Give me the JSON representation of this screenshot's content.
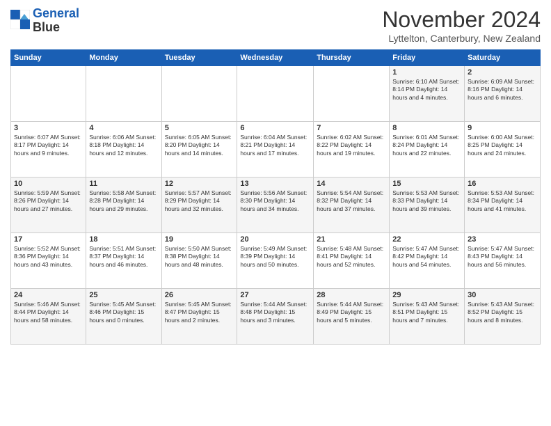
{
  "header": {
    "logo_line1": "General",
    "logo_line2": "Blue",
    "title": "November 2024",
    "location": "Lyttelton, Canterbury, New Zealand"
  },
  "days_of_week": [
    "Sunday",
    "Monday",
    "Tuesday",
    "Wednesday",
    "Thursday",
    "Friday",
    "Saturday"
  ],
  "weeks": [
    [
      {
        "day": "",
        "info": ""
      },
      {
        "day": "",
        "info": ""
      },
      {
        "day": "",
        "info": ""
      },
      {
        "day": "",
        "info": ""
      },
      {
        "day": "",
        "info": ""
      },
      {
        "day": "1",
        "info": "Sunrise: 6:10 AM\nSunset: 8:14 PM\nDaylight: 14 hours\nand 4 minutes."
      },
      {
        "day": "2",
        "info": "Sunrise: 6:09 AM\nSunset: 8:16 PM\nDaylight: 14 hours\nand 6 minutes."
      }
    ],
    [
      {
        "day": "3",
        "info": "Sunrise: 6:07 AM\nSunset: 8:17 PM\nDaylight: 14 hours\nand 9 minutes."
      },
      {
        "day": "4",
        "info": "Sunrise: 6:06 AM\nSunset: 8:18 PM\nDaylight: 14 hours\nand 12 minutes."
      },
      {
        "day": "5",
        "info": "Sunrise: 6:05 AM\nSunset: 8:20 PM\nDaylight: 14 hours\nand 14 minutes."
      },
      {
        "day": "6",
        "info": "Sunrise: 6:04 AM\nSunset: 8:21 PM\nDaylight: 14 hours\nand 17 minutes."
      },
      {
        "day": "7",
        "info": "Sunrise: 6:02 AM\nSunset: 8:22 PM\nDaylight: 14 hours\nand 19 minutes."
      },
      {
        "day": "8",
        "info": "Sunrise: 6:01 AM\nSunset: 8:24 PM\nDaylight: 14 hours\nand 22 minutes."
      },
      {
        "day": "9",
        "info": "Sunrise: 6:00 AM\nSunset: 8:25 PM\nDaylight: 14 hours\nand 24 minutes."
      }
    ],
    [
      {
        "day": "10",
        "info": "Sunrise: 5:59 AM\nSunset: 8:26 PM\nDaylight: 14 hours\nand 27 minutes."
      },
      {
        "day": "11",
        "info": "Sunrise: 5:58 AM\nSunset: 8:28 PM\nDaylight: 14 hours\nand 29 minutes."
      },
      {
        "day": "12",
        "info": "Sunrise: 5:57 AM\nSunset: 8:29 PM\nDaylight: 14 hours\nand 32 minutes."
      },
      {
        "day": "13",
        "info": "Sunrise: 5:56 AM\nSunset: 8:30 PM\nDaylight: 14 hours\nand 34 minutes."
      },
      {
        "day": "14",
        "info": "Sunrise: 5:54 AM\nSunset: 8:32 PM\nDaylight: 14 hours\nand 37 minutes."
      },
      {
        "day": "15",
        "info": "Sunrise: 5:53 AM\nSunset: 8:33 PM\nDaylight: 14 hours\nand 39 minutes."
      },
      {
        "day": "16",
        "info": "Sunrise: 5:53 AM\nSunset: 8:34 PM\nDaylight: 14 hours\nand 41 minutes."
      }
    ],
    [
      {
        "day": "17",
        "info": "Sunrise: 5:52 AM\nSunset: 8:36 PM\nDaylight: 14 hours\nand 43 minutes."
      },
      {
        "day": "18",
        "info": "Sunrise: 5:51 AM\nSunset: 8:37 PM\nDaylight: 14 hours\nand 46 minutes."
      },
      {
        "day": "19",
        "info": "Sunrise: 5:50 AM\nSunset: 8:38 PM\nDaylight: 14 hours\nand 48 minutes."
      },
      {
        "day": "20",
        "info": "Sunrise: 5:49 AM\nSunset: 8:39 PM\nDaylight: 14 hours\nand 50 minutes."
      },
      {
        "day": "21",
        "info": "Sunrise: 5:48 AM\nSunset: 8:41 PM\nDaylight: 14 hours\nand 52 minutes."
      },
      {
        "day": "22",
        "info": "Sunrise: 5:47 AM\nSunset: 8:42 PM\nDaylight: 14 hours\nand 54 minutes."
      },
      {
        "day": "23",
        "info": "Sunrise: 5:47 AM\nSunset: 8:43 PM\nDaylight: 14 hours\nand 56 minutes."
      }
    ],
    [
      {
        "day": "24",
        "info": "Sunrise: 5:46 AM\nSunset: 8:44 PM\nDaylight: 14 hours\nand 58 minutes."
      },
      {
        "day": "25",
        "info": "Sunrise: 5:45 AM\nSunset: 8:46 PM\nDaylight: 15 hours\nand 0 minutes."
      },
      {
        "day": "26",
        "info": "Sunrise: 5:45 AM\nSunset: 8:47 PM\nDaylight: 15 hours\nand 2 minutes."
      },
      {
        "day": "27",
        "info": "Sunrise: 5:44 AM\nSunset: 8:48 PM\nDaylight: 15 hours\nand 3 minutes."
      },
      {
        "day": "28",
        "info": "Sunrise: 5:44 AM\nSunset: 8:49 PM\nDaylight: 15 hours\nand 5 minutes."
      },
      {
        "day": "29",
        "info": "Sunrise: 5:43 AM\nSunset: 8:51 PM\nDaylight: 15 hours\nand 7 minutes."
      },
      {
        "day": "30",
        "info": "Sunrise: 5:43 AM\nSunset: 8:52 PM\nDaylight: 15 hours\nand 8 minutes."
      }
    ]
  ]
}
